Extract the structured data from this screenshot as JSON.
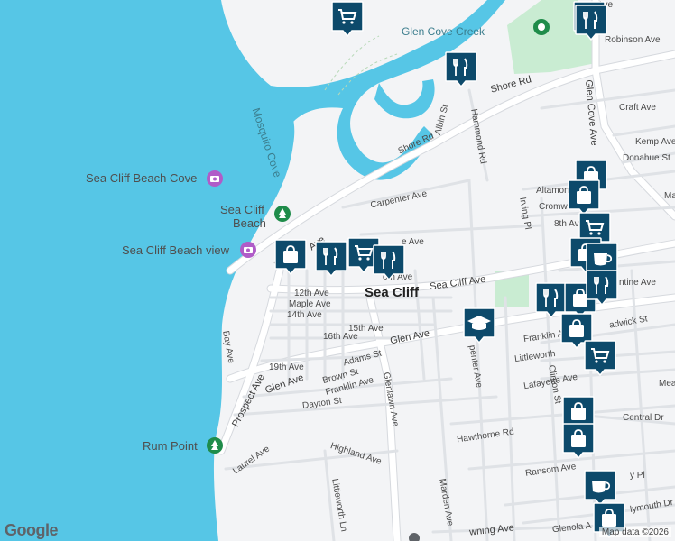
{
  "map": {
    "attribution": "Map data ©2026",
    "logo": "Google"
  },
  "labels": {
    "creek": "Glen Cove Creek",
    "mosquito_cove": "Mosquito Cove",
    "sea_cliff_beach_cove": "Sea Cliff Beach Cove",
    "sea_cliff_beach_1": "Sea Cliff",
    "sea_cliff_beach_2": "Beach",
    "sea_cliff_beach_view": "Sea Cliff Beach view",
    "rum_point": "Rum Point",
    "sea_cliff": "Sea Cliff",
    "shore_rd_1": "Shore Rd",
    "shore_rd_2": "Shore Rd",
    "robinson": "Robinson Ave",
    "glen_cove_ave": "Glen Cove Ave",
    "craft": "Craft Ave",
    "kemp": "Kemp Ave",
    "donahue": "Donahue St",
    "albin": "Albin St",
    "hammond": "Hammond Rd",
    "carpenter": "Carpenter Ave",
    "altamont": "Altamont",
    "cromwell": "Cromw",
    "irving": "Irving Pl",
    "eighth": "8th Av",
    "sea_cliff_ave": "Sea Cliff Ave",
    "twelfth": "12th Ave",
    "maple": "Maple Ave",
    "fourteenth": "14th Ave",
    "fifteenth": "15th Ave",
    "sixteenth": "16th Ave",
    "glen_ave_1": "Glen Ave",
    "glen_ave_2": "Glen Ave",
    "bay": "Bay Ave",
    "nineteenth": "19th Ave",
    "adams": "Adams St",
    "brown": "Brown St",
    "franklin_ave": "Franklin Ave",
    "dayton": "Dayton St",
    "prospect_1": "Prospect Ave",
    "prospect_2": "P",
    "prospect_ave_short": "Ave",
    "glenlawn": "Glenlawn Ave",
    "carpenter_ave_s": "penter Ave",
    "franklin_right": "Franklin A",
    "littleworth_right": "Littleworth",
    "chadwick": "adwick St",
    "valentine": "ntine Ave",
    "lafayette": "Lafayette Ave",
    "central": "Central Dr",
    "mea": "Mea",
    "clinton": "Clinton St",
    "hawthorne": "Hawthorne Rd",
    "laurel": "Laurel Ave",
    "highland": "Highland Ave",
    "littleworth_ln": "Littleworth Ln",
    "marden": "Marden Ave",
    "ransom": "Ransom Ave",
    "ray": "y Pl",
    "glenola": "Glenola A",
    "plymouth": "lymouth Dr",
    "downing": "wning Ave",
    "oth": "oth Ave",
    "ave_top": "Ave",
    "e_ave": "e Ave",
    "ma": "Ma"
  },
  "colors": {
    "water": "#56c6e6",
    "land": "#f3f4f6",
    "road": "#ffffff",
    "road_edge": "#d6d9de",
    "park": "#c9ecd2",
    "marker": "#0d4a6b",
    "poi": "#b05cc8",
    "park_icon": "#1f8c4a"
  },
  "markers": [
    {
      "name": "shopping-cart-marker",
      "icon": "cart"
    },
    {
      "name": "restaurant-marker",
      "icon": "fork-knife"
    },
    {
      "name": "restaurant-marker",
      "icon": "fork-knife"
    },
    {
      "name": "shopping-bag-marker",
      "icon": "bag"
    },
    {
      "name": "restaurant-marker",
      "icon": "fork-knife"
    },
    {
      "name": "shopping-cart-marker",
      "icon": "cart"
    },
    {
      "name": "restaurant-marker",
      "icon": "fork-knife"
    },
    {
      "name": "school-marker",
      "icon": "graduation-cap"
    },
    {
      "name": "shopping-bag-marker",
      "icon": "bag"
    },
    {
      "name": "shopping-bag-marker",
      "icon": "bag"
    },
    {
      "name": "shopping-cart-marker",
      "icon": "cart"
    },
    {
      "name": "shopping-bag-marker",
      "icon": "bag"
    },
    {
      "name": "cafe-marker",
      "icon": "cup"
    },
    {
      "name": "restaurant-marker",
      "icon": "fork-knife"
    },
    {
      "name": "shopping-bag-marker",
      "icon": "bag"
    },
    {
      "name": "restaurant-marker",
      "icon": "fork-knife"
    },
    {
      "name": "shopping-bag-marker",
      "icon": "bag"
    },
    {
      "name": "shopping-cart-marker",
      "icon": "cart"
    },
    {
      "name": "shopping-bag-marker",
      "icon": "bag"
    },
    {
      "name": "shopping-bag-marker",
      "icon": "bag"
    },
    {
      "name": "cafe-marker",
      "icon": "cup"
    },
    {
      "name": "shopping-bag-marker",
      "icon": "bag"
    },
    {
      "name": "restaurant-marker",
      "icon": "fork-knife"
    }
  ]
}
